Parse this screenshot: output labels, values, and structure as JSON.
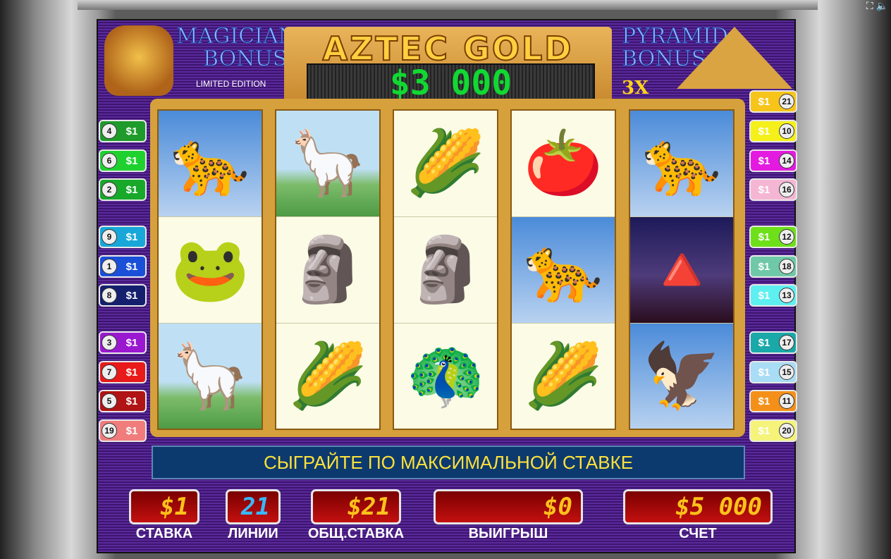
{
  "title": "AZTEC GOLD",
  "jackpot": "$3 000",
  "left_bonus": {
    "line1": "MAGICIAN",
    "line2": "BONUS",
    "edition": "LIMITED EDITION"
  },
  "right_bonus": {
    "line1": "PYRAMID",
    "line2": "BONUS",
    "multiplier": "3X"
  },
  "reels": [
    [
      "puma",
      "frog",
      "llama"
    ],
    [
      "llama",
      "aztec-head",
      "corn"
    ],
    [
      "corn",
      "aztec-head",
      "bird"
    ],
    [
      "tomato",
      "puma",
      "corn"
    ],
    [
      "puma",
      "pyramid",
      "eagle"
    ]
  ],
  "left_lines": [
    {
      "num": "4",
      "amt": "$1",
      "color": "#1e9b2a"
    },
    {
      "num": "6",
      "amt": "$1",
      "color": "#1fd12f"
    },
    {
      "num": "2",
      "amt": "$1",
      "color": "#18a82a"
    },
    {
      "num": "9",
      "amt": "$1",
      "color": "#18a7d8"
    },
    {
      "num": "1",
      "amt": "$1",
      "color": "#1a4fd8"
    },
    {
      "num": "8",
      "amt": "$1",
      "color": "#14206e"
    },
    {
      "num": "3",
      "amt": "$1",
      "color": "#9a18d0"
    },
    {
      "num": "7",
      "amt": "$1",
      "color": "#e81a1a"
    },
    {
      "num": "5",
      "amt": "$1",
      "color": "#b01414"
    },
    {
      "num": "19",
      "amt": "$1",
      "color": "#f07c7c"
    }
  ],
  "right_lines": [
    {
      "num": "21",
      "amt": "$1",
      "color": "#f7c41a"
    },
    {
      "num": "10",
      "amt": "$1",
      "color": "#f5f01a"
    },
    {
      "num": "14",
      "amt": "$1",
      "color": "#e41ae0"
    },
    {
      "num": "16",
      "amt": "$1",
      "color": "#f5b6d4"
    },
    {
      "num": "12",
      "amt": "$1",
      "color": "#6ee01a"
    },
    {
      "num": "18",
      "amt": "$1",
      "color": "#6fc9a8"
    },
    {
      "num": "13",
      "amt": "$1",
      "color": "#5ef0f0"
    },
    {
      "num": "17",
      "amt": "$1",
      "color": "#1aa8a8"
    },
    {
      "num": "15",
      "amt": "$1",
      "color": "#a9dcf5"
    },
    {
      "num": "11",
      "amt": "$1",
      "color": "#f4901a"
    },
    {
      "num": "20",
      "amt": "$1",
      "color": "#f5f37a"
    }
  ],
  "message": "СЫГРАЙТЕ ПО МАКСИМАЛЬНОЙ СТАВКЕ",
  "displays": {
    "bet": {
      "value": "$1",
      "label": "СТАВКА"
    },
    "lines": {
      "value": "21",
      "label": "ЛИНИИ"
    },
    "total_bet": {
      "value": "$21",
      "label": "ОБЩ.СТАВКА"
    },
    "win": {
      "value": "$0",
      "label": "ВЫИГРЫШ"
    },
    "balance": {
      "value": "$5 000",
      "label": "СЧЕТ"
    }
  }
}
